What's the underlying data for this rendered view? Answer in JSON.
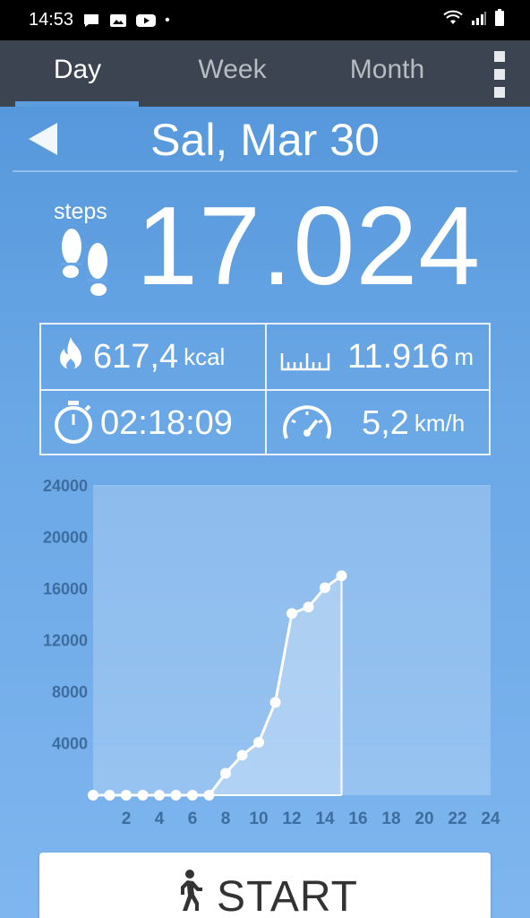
{
  "status_bar": {
    "time": "14:53",
    "dot": "•"
  },
  "tabs": [
    {
      "label": "Day",
      "active": true
    },
    {
      "label": "Week",
      "active": false
    },
    {
      "label": "Month",
      "active": false
    }
  ],
  "header": {
    "date": "Sal, Mar 30"
  },
  "steps": {
    "label": "steps",
    "value": "17.024"
  },
  "stats": {
    "calories": {
      "value": "617,4",
      "unit": "kcal"
    },
    "distance": {
      "value": "11.916",
      "unit": "m"
    },
    "duration": {
      "value": "02:18:09"
    },
    "speed": {
      "value": "5,2",
      "unit": "km/h"
    }
  },
  "chart_data": {
    "type": "line",
    "x_ticks": [
      "2",
      "4",
      "6",
      "8",
      "10",
      "12",
      "14",
      "16",
      "18",
      "20",
      "22",
      "24"
    ],
    "y_ticks": [
      "4000",
      "8000",
      "12000",
      "16000",
      "20000",
      "24000"
    ],
    "xlim": [
      0,
      24
    ],
    "ylim": [
      0,
      24000
    ],
    "x": [
      0,
      1,
      2,
      3,
      4,
      5,
      6,
      7,
      8,
      9,
      10,
      11,
      12,
      13,
      14,
      15
    ],
    "y": [
      0,
      0,
      0,
      0,
      0,
      0,
      0,
      0,
      1700,
      3100,
      4100,
      7200,
      14100,
      14600,
      16100,
      17024
    ],
    "colors": {
      "line": "#ffffff",
      "grid": "#8fc0f2",
      "axis_text": "#3d6d9f"
    }
  },
  "start_button": {
    "label": "START"
  }
}
